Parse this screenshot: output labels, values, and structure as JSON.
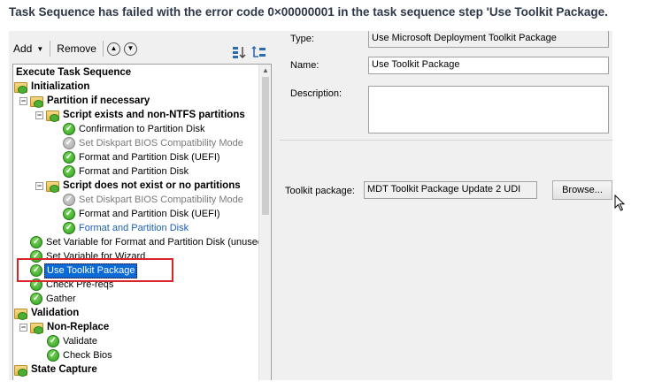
{
  "headline": "Task Sequence has failed with the error code 0×00000001 in the task sequence step 'Use Toolkit Package.",
  "toolbar": {
    "add_label": "Add",
    "remove_label": "Remove",
    "up_icon": "move-up-icon",
    "down_icon": "move-down-icon"
  },
  "tree": {
    "root": "Execute Task Sequence",
    "items": [
      {
        "label": "Initialization"
      },
      {
        "label": "Partition if necessary"
      },
      {
        "label": "Script exists and non-NTFS partitions"
      },
      {
        "label": "Confirmation to Partition Disk"
      },
      {
        "label": "Set Diskpart BIOS Compatibility Mode"
      },
      {
        "label": "Format and Partition Disk (UEFI)"
      },
      {
        "label": "Format and Partition Disk"
      },
      {
        "label": "Script does not exist or no partitions"
      },
      {
        "label": "Set Diskpart BIOS Compatibility Mode"
      },
      {
        "label": "Format and Partition Disk (UEFI)"
      },
      {
        "label": "Format and Partition Disk"
      },
      {
        "label": "Set Variable for Format and Partition Disk (unused"
      },
      {
        "label": "Set Variable for Wizard"
      },
      {
        "label": "Use Toolkit Package"
      },
      {
        "label": "Check Pre-reqs"
      },
      {
        "label": "Gather"
      },
      {
        "label": "Validation"
      },
      {
        "label": "Non-Replace"
      },
      {
        "label": "Validate"
      },
      {
        "label": "Check Bios"
      },
      {
        "label": "State Capture"
      }
    ]
  },
  "properties": {
    "type_label": "Type:",
    "type_value": "Use Microsoft Deployment Toolkit Package",
    "name_label": "Name:",
    "name_value": "Use Toolkit Package",
    "description_label": "Description:",
    "description_value": "",
    "package_label": "Toolkit package:",
    "package_value": "MDT Toolkit Package Update 2 UDI",
    "browse_label": "Browse..."
  },
  "colors": {
    "selection": "#0a6ad6",
    "highlight_box": "#d9252a",
    "success_check": "#2e9b1f"
  }
}
